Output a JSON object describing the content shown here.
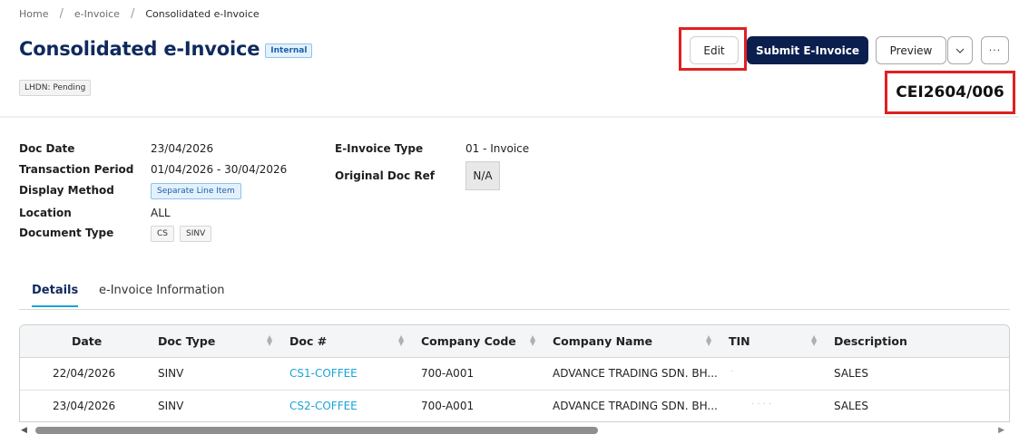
{
  "breadcrumb": {
    "items": [
      "Home",
      "e-Invoice",
      "Consolidated e-Invoice"
    ],
    "separator": "/"
  },
  "header": {
    "title": "Consolidated e-Invoice",
    "internal_badge": "Internal",
    "lhdn_status": "LHDN: Pending",
    "doc_number": "CEI2604/006"
  },
  "toolbar": {
    "edit_label": "Edit",
    "submit_label": "Submit E-Invoice",
    "preview_label": "Preview",
    "dropdown_glyph": "⌄",
    "more_glyph": "···"
  },
  "info": {
    "doc_date_label": "Doc Date",
    "doc_date_value": "23/04/2026",
    "transaction_period_label": "Transaction Period",
    "transaction_period_value": "01/04/2026 - 30/04/2026",
    "display_method_label": "Display Method",
    "display_method_value": "Separate Line Item",
    "location_label": "Location",
    "location_value": "ALL",
    "document_type_label": "Document Type",
    "document_types": [
      "CS",
      "SINV"
    ],
    "einvoice_type_label": "E-Invoice Type",
    "einvoice_type_value": "01 - Invoice",
    "original_doc_ref_label": "Original Doc Ref",
    "original_doc_ref_value": "N/A"
  },
  "tabs": [
    {
      "label": "Details",
      "active": true
    },
    {
      "label": "e-Invoice Information",
      "active": false
    }
  ],
  "table": {
    "columns": [
      "Date",
      "Doc Type",
      "Doc #",
      "Company Code",
      "Company Name",
      "TIN",
      "Description"
    ],
    "rows": [
      {
        "date": "22/04/2026",
        "doc_type": "SINV",
        "doc_no": "CS1-COFFEE",
        "company_code": "700-A001",
        "company_name": "ADVANCE TRADING SDN. BH...",
        "tin": "·",
        "description": "SALES"
      },
      {
        "date": "23/04/2026",
        "doc_type": "SINV",
        "doc_no": "CS2-COFFEE",
        "company_code": "700-A001",
        "company_name": "ADVANCE TRADING SDN. BH...",
        "tin": "· · · ·",
        "description": "SALES"
      }
    ]
  },
  "colors": {
    "primary": "#0b1f4f",
    "title": "#0f2a5c",
    "link": "#1aa3d9",
    "highlight": "#e02020"
  },
  "icons": {
    "sort": "sort-icon",
    "scroll_left": "arrow-left-icon",
    "scroll_right": "arrow-right-icon"
  }
}
